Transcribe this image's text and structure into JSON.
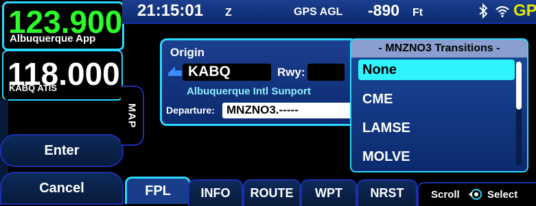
{
  "frequencies": {
    "active": {
      "value": "123.900",
      "name": "Albuquerque App"
    },
    "standby": {
      "value": "118.000",
      "name": "KABQ ATIS"
    }
  },
  "side_buttons": {
    "enter": "Enter",
    "cancel": "Cancel"
  },
  "map_tab": "MAP",
  "status_bar": {
    "time": "21:15:01",
    "time_suffix": "Z",
    "agl_label": "GPS AGL",
    "agl_value": "-890",
    "agl_unit": "Ft",
    "gps": "GPS",
    "gps_color": "#e6e600"
  },
  "origin": {
    "title": "Origin",
    "airport": "KABQ",
    "runway_label": "Rwy:",
    "runway_value": "",
    "airport_name": "Albuquerque Intl Sunport",
    "departure_label": "Departure:",
    "departure_value": "MNZNO3.-----"
  },
  "transitions": {
    "title": "- MNZNO3 Transitions -",
    "items": [
      "None",
      "CME",
      "LAMSE",
      "MOLVE"
    ],
    "selected_index": 0
  },
  "tabs": [
    "FPL",
    "INFO",
    "ROUTE",
    "WPT",
    "NRST"
  ],
  "active_tab": "FPL",
  "hint": {
    "scroll": "Scroll",
    "select": "Select"
  },
  "colors": {
    "accent": "#2bd9ff",
    "active_freq": "#2bff2b",
    "selection": "#2ff4ff"
  }
}
